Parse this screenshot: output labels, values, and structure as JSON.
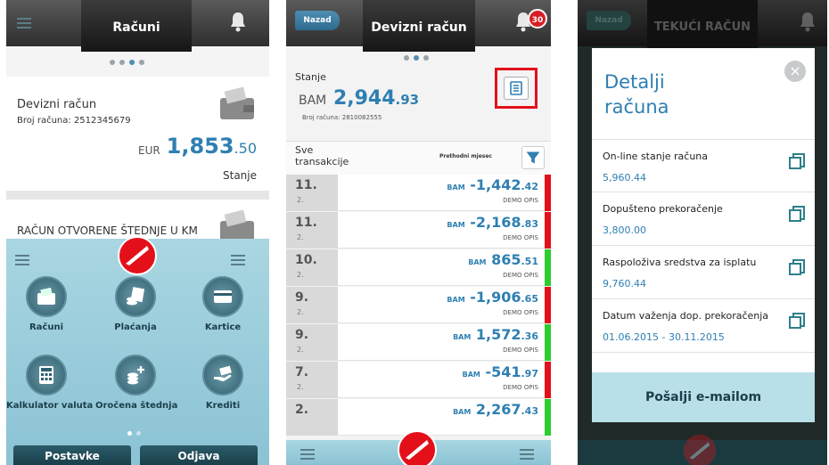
{
  "screen1": {
    "title": "Računi",
    "account": {
      "name": "Devizni račun",
      "number_label": "Broj računa:",
      "number": "2512345679",
      "currency": "EUR",
      "balance_main": "1,853",
      "balance_dec": ".50",
      "balance_label": "Stanje"
    },
    "account2_name": "RAČUN OTVORENE ŠTEDNJE U KM",
    "menu": [
      {
        "label": "Računi",
        "icon": "wallet-icon"
      },
      {
        "label": "Plaćanja",
        "icon": "coins-icon"
      },
      {
        "label": "Kartice",
        "icon": "card-icon"
      },
      {
        "label": "Kalkulator valuta",
        "icon": "calculator-icon"
      },
      {
        "label": "Oročena štednja",
        "icon": "savings-icon"
      },
      {
        "label": "Krediti",
        "icon": "loan-icon"
      }
    ],
    "buttons": {
      "settings": "Postavke",
      "logout": "Odjava"
    }
  },
  "screen2": {
    "back": "Nazad",
    "title": "Devizni račun",
    "notifications": "30",
    "balance_label": "Stanje",
    "currency": "BAM",
    "balance_main": "2,944",
    "balance_dec": ".93",
    "account_number_label": "Broj računa:",
    "account_number": "2810082555",
    "transactions_label_1": "Sve",
    "transactions_label_2": "transakcije",
    "period": "Prethodni mjesec",
    "transactions": [
      {
        "day": "11.",
        "month": "2.",
        "currency": "BAM",
        "amount_main": "-1,442",
        "amount_dec": ".42",
        "desc": "DEMO OPIS",
        "status_color": "#e3101a"
      },
      {
        "day": "11.",
        "month": "2.",
        "currency": "BAM",
        "amount_main": "-2,168",
        "amount_dec": ".83",
        "desc": "DEMO OPIS",
        "status_color": "#e3101a"
      },
      {
        "day": "10.",
        "month": "2.",
        "currency": "BAM",
        "amount_main": "865",
        "amount_dec": ".51",
        "desc": "DEMO OPIS",
        "status_color": "#2ecc2e"
      },
      {
        "day": "9.",
        "month": "2.",
        "currency": "BAM",
        "amount_main": "-1,906",
        "amount_dec": ".65",
        "desc": "DEMO OPIS",
        "status_color": "#e3101a"
      },
      {
        "day": "9.",
        "month": "2.",
        "currency": "BAM",
        "amount_main": "1,572",
        "amount_dec": ".36",
        "desc": "DEMO OPIS",
        "status_color": "#2ecc2e"
      },
      {
        "day": "7.",
        "month": "2.",
        "currency": "BAM",
        "amount_main": "-541",
        "amount_dec": ".97",
        "desc": "DEMO OPIS",
        "status_color": "#e3101a"
      },
      {
        "day": "2.",
        "month": "",
        "currency": "BAM",
        "amount_main": "2,267",
        "amount_dec": ".43",
        "desc": "",
        "status_color": "#2ecc2e"
      }
    ]
  },
  "screen3": {
    "back": "Nazad",
    "title": "TEKUĆI RAČUN",
    "modal_title_1": "Detalji",
    "modal_title_2": "računa",
    "close": "×",
    "details": [
      {
        "label": "On-line stanje računa",
        "value": "5,960.44"
      },
      {
        "label": "Dopušteno prekoračenje",
        "value": "3,800.00"
      },
      {
        "label": "Raspoloživa sredstva za isplatu",
        "value": "9,760.44"
      },
      {
        "label": "Datum važenja dop. prekoračenja",
        "value": "01.06.2015 - 30.11.2015"
      }
    ],
    "send_button": "Pošalji e-mailom"
  },
  "colors": {
    "accent_blue": "#2f7fb2",
    "menu_teal": "#a9d6e2",
    "negative": "#e3101a",
    "positive": "#2ecc2e"
  }
}
